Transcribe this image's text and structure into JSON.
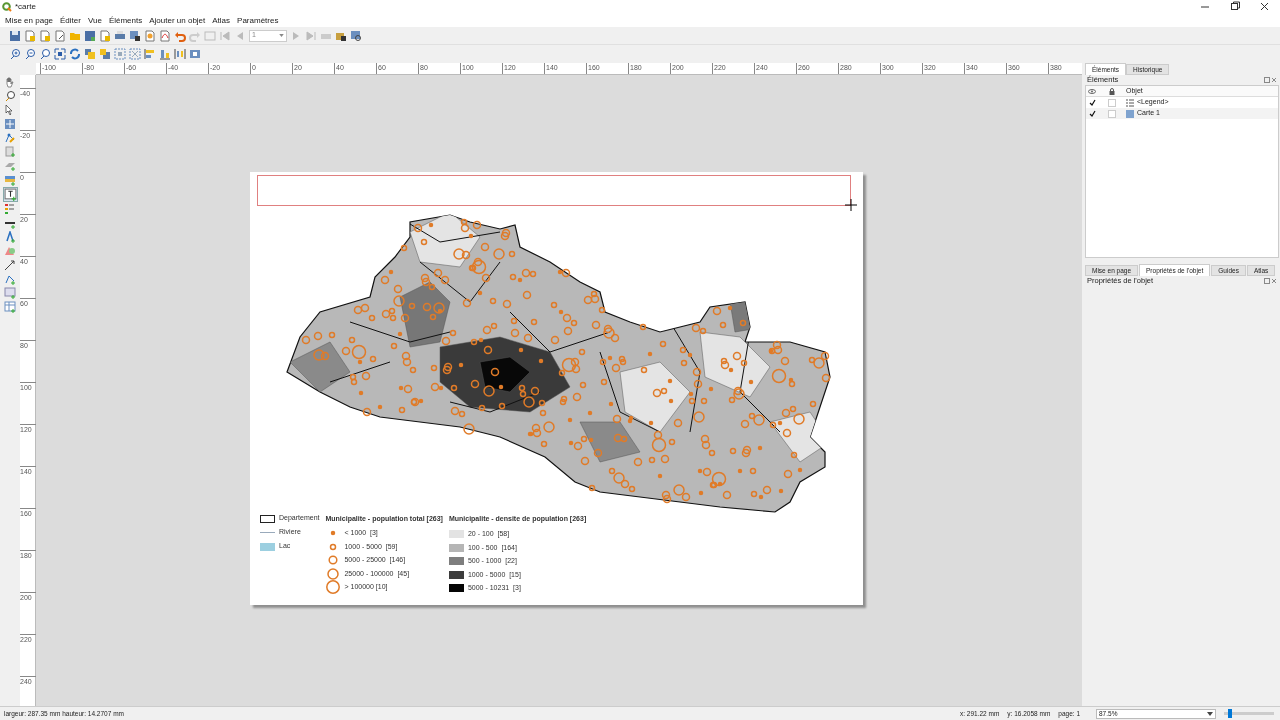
{
  "window": {
    "title": "*carte"
  },
  "menu": [
    "Mise en page",
    "Éditer",
    "Vue",
    "Éléments",
    "Ajouter un objet",
    "Atlas",
    "Paramètres"
  ],
  "atlas_page": {
    "value": "1"
  },
  "ruler": {
    "x_ticks": [
      "-100",
      "-80",
      "-60",
      "-40",
      "-20",
      "0",
      "20",
      "40",
      "60",
      "80",
      "100",
      "120",
      "140",
      "160",
      "180",
      "200",
      "220",
      "240",
      "260",
      "280",
      "300",
      "320",
      "340",
      "360",
      "380"
    ],
    "y_ticks": [
      "-40",
      "-20",
      "0",
      "20",
      "40",
      "60",
      "80",
      "100",
      "120",
      "140",
      "160",
      "180",
      "200",
      "220",
      "240"
    ]
  },
  "legend": {
    "left": [
      {
        "kind": "outline",
        "label": "Departement"
      },
      {
        "kind": "line",
        "label": "Riviere"
      },
      {
        "kind": "fill",
        "label": "Lac",
        "color": "#9ccfe0"
      }
    ],
    "population": {
      "title": "Municipalite - population total [263]",
      "items": [
        "< 1000  [3]",
        "1000 - 5000  [59]",
        "5000 - 25000  [146]",
        "25000 - 100000  [45]",
        "> 100000 [10]"
      ]
    },
    "density": {
      "title": "Municipalite - densite de population [263]",
      "items": [
        {
          "label": "20 - 100  [58]",
          "color": "#e3e3e3"
        },
        {
          "label": "100 - 500  [164]",
          "color": "#b5b5b5"
        },
        {
          "label": "500 - 1000  [22]",
          "color": "#7e7e7e"
        },
        {
          "label": "1000 - 5000  [15]",
          "color": "#3c3c3c"
        },
        {
          "label": "5000 - 10231  [3]",
          "color": "#050505"
        }
      ]
    }
  },
  "panel_tabs": [
    {
      "label": "Éléments",
      "selected": true
    },
    {
      "label": "Historique",
      "selected": false
    }
  ],
  "items_panel": {
    "title": "Éléments",
    "column": "Objet",
    "rows": [
      {
        "visible": true,
        "locked": false,
        "kind": "legend",
        "label": "<Legend>"
      },
      {
        "visible": true,
        "locked": false,
        "kind": "map",
        "label": "Carte 1"
      }
    ]
  },
  "bottom_tabs": [
    {
      "label": "Mise en page",
      "selected": false
    },
    {
      "label": "Propriétés de l'objet",
      "selected": true
    },
    {
      "label": "Guides",
      "selected": false
    },
    {
      "label": "Atlas",
      "selected": false
    }
  ],
  "properties_panel": {
    "title": "Propriétés de l'objet"
  },
  "status_bar": {
    "size": "largeur: 287.35 mm hauteur: 14.2707 mm",
    "x": "x: 291.22 mm",
    "y": "y: 16.2058 mm",
    "page": "page: 1",
    "zoom": "87.5%",
    "level": 0.08
  }
}
